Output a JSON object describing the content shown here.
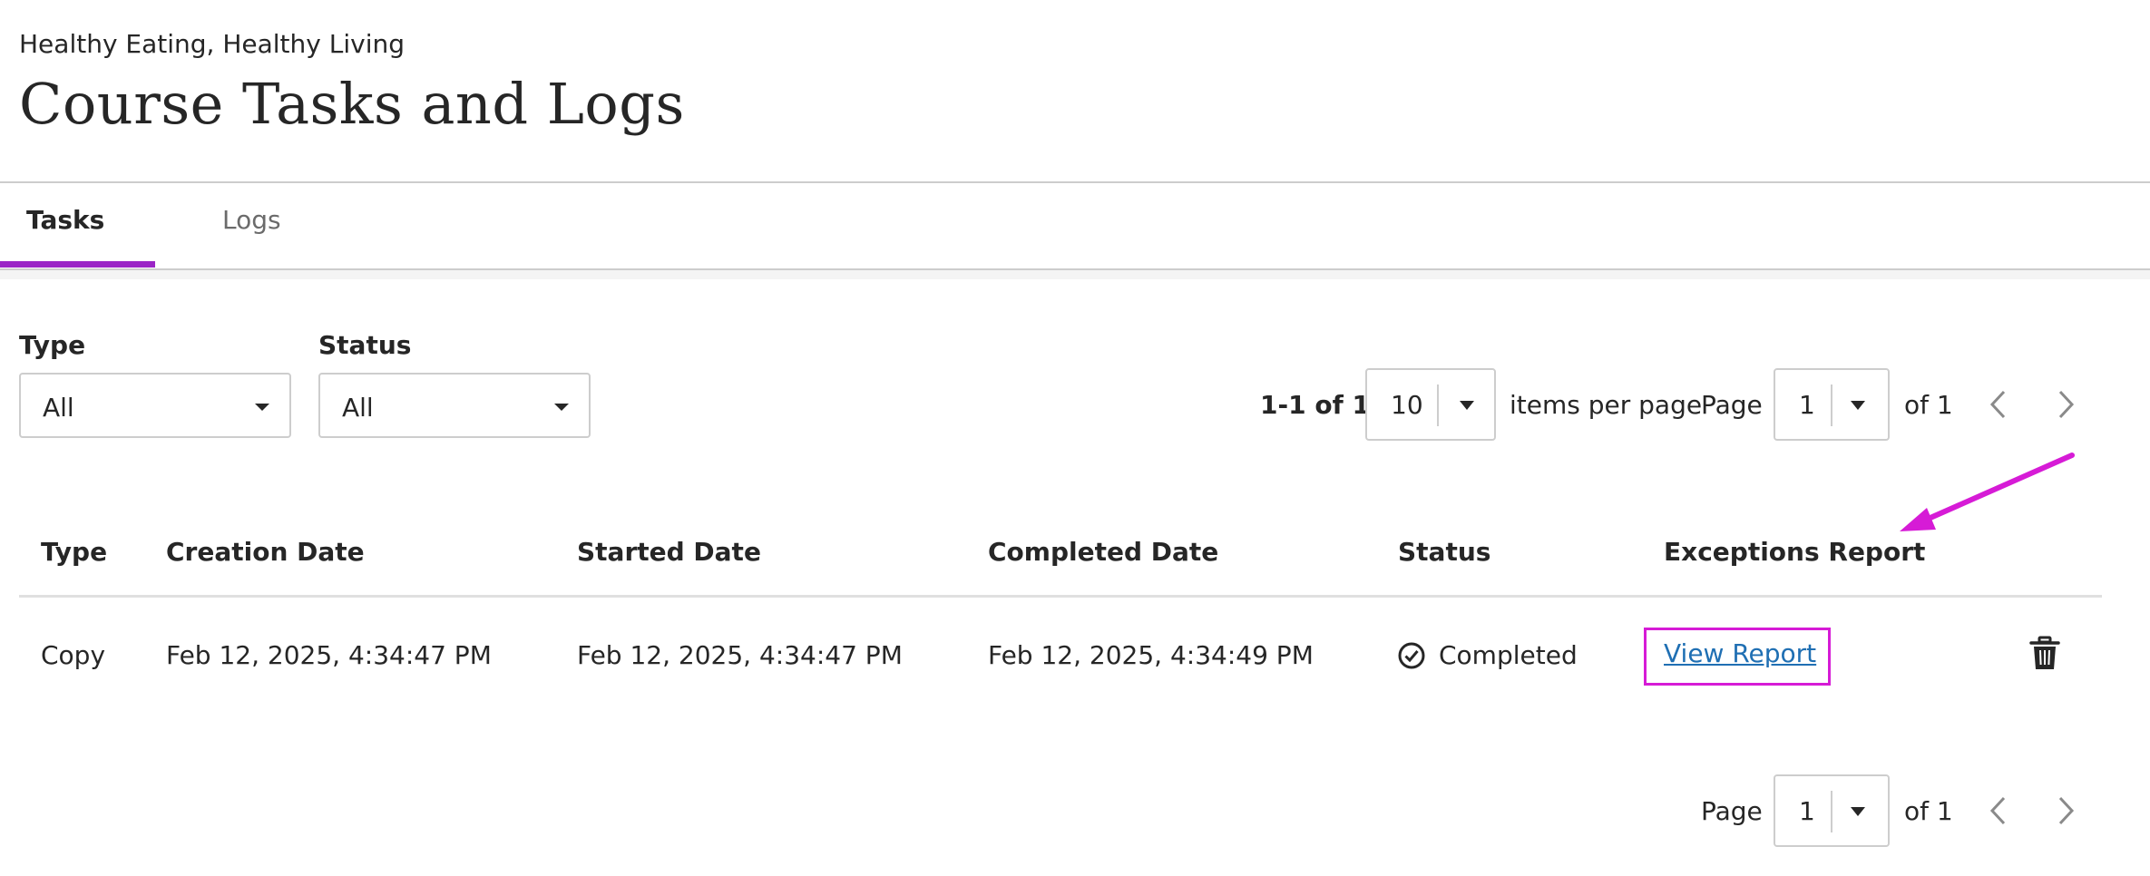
{
  "header": {
    "course_name": "Healthy Eating, Healthy Living",
    "title": "Course Tasks and Logs"
  },
  "tabs": [
    {
      "label": "Tasks",
      "selected": true
    },
    {
      "label": "Logs",
      "selected": false
    }
  ],
  "filters": {
    "type": {
      "label": "Type",
      "value": "All"
    },
    "status": {
      "label": "Status",
      "value": "All"
    }
  },
  "pagination_top": {
    "range": "1-1 of 1",
    "per_page": "10",
    "per_page_label": "items per page",
    "page_label": "Page",
    "page": "1",
    "of": "of 1"
  },
  "pagination_bottom": {
    "page_label": "Page",
    "page": "1",
    "of": "of 1"
  },
  "table": {
    "columns": [
      "Type",
      "Creation Date",
      "Started Date",
      "Completed Date",
      "Status",
      "Exceptions Report"
    ],
    "rows": [
      {
        "type": "Copy",
        "creation": "Feb 12, 2025, 4:34:47 PM",
        "started": "Feb 12, 2025, 4:34:47 PM",
        "completed": "Feb 12, 2025, 4:34:49 PM",
        "status": "Completed",
        "report_link": "View Report"
      }
    ]
  },
  "icons": {
    "status_icon": "check-circle-icon",
    "delete_icon": "trash-icon",
    "prev_icon": "chevron-left-icon",
    "next_icon": "chevron-right-icon",
    "annotation": "arrow-icon"
  },
  "colors": {
    "accent": "#9b26c6",
    "highlight": "#d61bd6",
    "link": "#1f6fb3"
  }
}
